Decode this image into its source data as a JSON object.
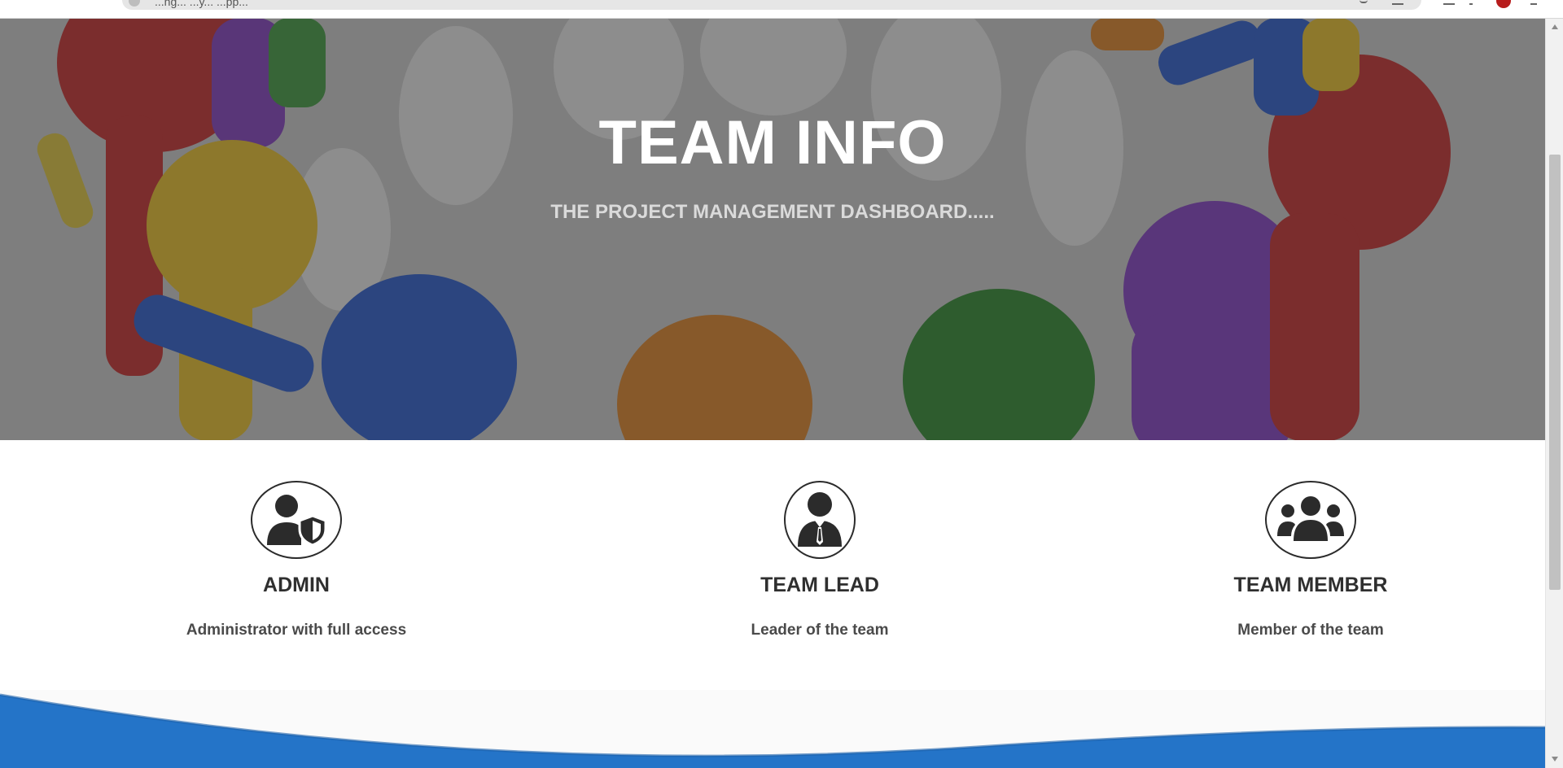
{
  "browser": {
    "url_text": "...ng... ...y... ...pp...",
    "icons": [
      "key-icon",
      "star-icon",
      "menu-icon",
      "extensions-icon",
      "profile-icon",
      "more-icon"
    ]
  },
  "hero": {
    "title": "TEAM INFO",
    "subtitle": "THE PROJECT MANAGEMENT DASHBOARD....."
  },
  "roles": [
    {
      "icon": "user-shield-icon",
      "title": "ADMIN",
      "description": "Administrator with full access"
    },
    {
      "icon": "user-tie-icon",
      "title": "TEAM LEAD",
      "description": "Leader of the team"
    },
    {
      "icon": "users-group-icon",
      "title": "TEAM MEMBER",
      "description": "Member of the team"
    }
  ],
  "colors": {
    "wave_blue": "#2474c8",
    "heading": "#2f2f2f",
    "hero_overlay": "#555555"
  }
}
